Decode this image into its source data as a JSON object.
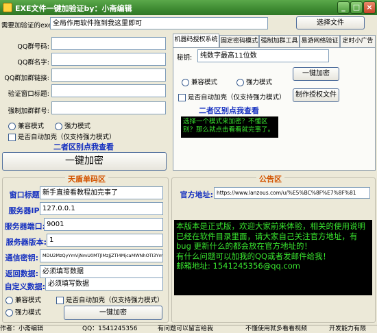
{
  "window": {
    "title": "EXE文件一键加验证by：小斋编辑"
  },
  "top": {
    "exe_label": "需要加验证的exe:",
    "exe_value": "全局作用软件拖到我这里即可",
    "select_button": "选择文件"
  },
  "form": {
    "fields": [
      {
        "label": "QQ群号码:",
        "value": ""
      },
      {
        "label": "QQ群名字:",
        "value": ""
      },
      {
        "label": "QQ群加群链接:",
        "value": ""
      },
      {
        "label": "验证窗口标题:",
        "value": ""
      },
      {
        "label": "强制加群群号:",
        "value": ""
      }
    ],
    "compat_mode": "兼容模式",
    "strong_mode": "强力模式",
    "auto_shell": "是否自动加壳（仅支持强力模式）",
    "hint": "二者区别点我查看",
    "one_click": "一键加密"
  },
  "tabs": {
    "items": [
      "机器码授权系统",
      "固定密码模式",
      "强制加群工具",
      "易游网络验证",
      "定时小广告"
    ],
    "secret_label": "秘钥:",
    "secret_value": "纯数字最高11位数",
    "compat_mode": "兼容模式",
    "strong_mode": "强力模式",
    "encrypt_button": "一键加密",
    "auto_shell": "是否自动加壳（仅支持强力模式）",
    "make_license": "制作授权文件",
    "hint": "二者区别点我查看",
    "info_text": "选择一个模式来加密？不懂区别？那么就点击看看就完事了。"
  },
  "tiandun": {
    "title": "天盾单码区",
    "rows": [
      {
        "label": "窗口标题:",
        "value": "新手直接看教程加完事了"
      },
      {
        "label": "服务器IP:",
        "value": "127.0.0.1"
      },
      {
        "label": "服务器端口:",
        "value": "9001"
      },
      {
        "label": "服务器版本:",
        "value": "1"
      },
      {
        "label": "通信密钥:",
        "value": "MDU2MzQyYmVjNmU0MTJlMzJjZTI4MjcaMWNhOTI3YmUx"
      },
      {
        "label": "返回数据:",
        "value": "必须填写数据"
      },
      {
        "label": "自定义数据:",
        "value": "必须填写数据"
      }
    ],
    "compat_mode": "兼容模式",
    "strong_mode": "强力模式",
    "auto_shell": "是否自动加壳（仅支持强力模式）",
    "encrypt_button": "一键加密"
  },
  "notice": {
    "title": "公告区",
    "site_label": "官方地址:",
    "site_value": "https://www.lanzous.com/u/%E5%BC%8F%E7%8F%81",
    "body": "本版本是正式版，欢迎大家前来体验，相关的使用说明已经在软件目录里面，请大家自己关注官方地址，有bug 更新什么的都会放在官方地址的！\n有什么问题可以加我的QQ或者发邮件给我！\n邮箱地址: 1541245356@qq.com"
  },
  "statusbar": {
    "items": [
      "作者：小斋编辑",
      "QQ：1541245356",
      "有问题可以留言给我",
      "不懂使用就多看看视频",
      "开发能力有限"
    ]
  },
  "colors": {
    "titlebar": "#3e8a32",
    "notice_bg": "#000000",
    "notice_text": "#39e52f",
    "label_blue": "#1530c0",
    "title_orange": "#d35400"
  }
}
